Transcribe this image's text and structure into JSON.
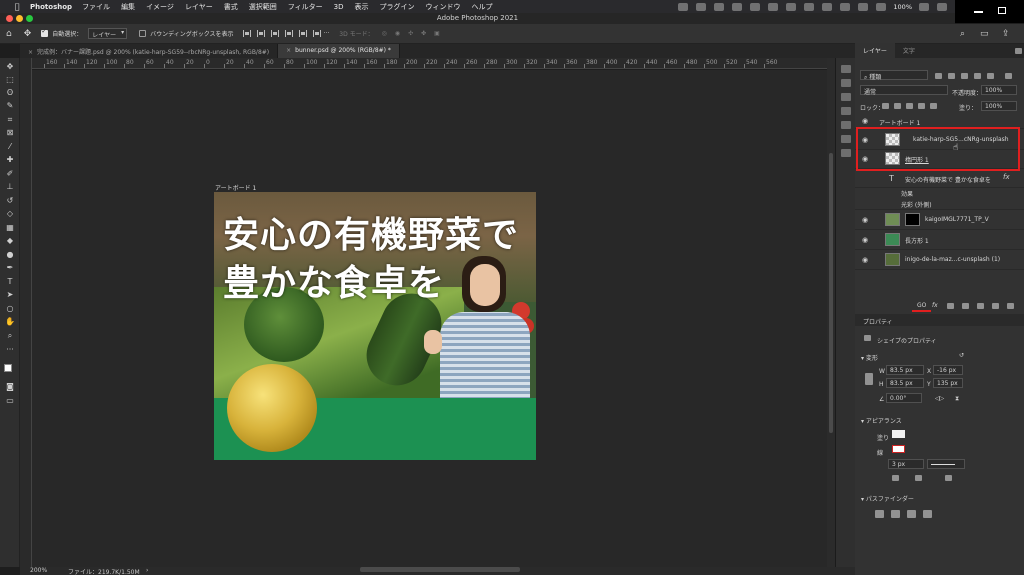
{
  "menubar": {
    "app_name": "Photoshop",
    "items": [
      "ファイル",
      "編集",
      "イメージ",
      "レイヤー",
      "書式",
      "選択範囲",
      "フィルター",
      "3D",
      "表示",
      "プラグイン",
      "ウィンドウ",
      "ヘルプ"
    ],
    "battery": "100%"
  },
  "window": {
    "title": "Adobe Photoshop 2021"
  },
  "options": {
    "auto_select_label": "自動選択：",
    "auto_select_value": "レイヤー",
    "bounding_box_label": "バウンディングボックスを表示",
    "mode_3d": "3D モード："
  },
  "tabs": [
    {
      "label": "完成例：バナー課題.psd @ 200% (katie-harp-SG59--rbcNRg-unsplash, RGB/8#)"
    },
    {
      "label": "bunner.psd @ 200% (RGB/8#) *"
    }
  ],
  "ruler": {
    "ticks": [
      "160",
      "140",
      "120",
      "100",
      "80",
      "60",
      "40",
      "20",
      "0",
      "20",
      "40",
      "60",
      "80",
      "100",
      "120",
      "140",
      "160",
      "180",
      "200",
      "220",
      "240",
      "260",
      "280",
      "300",
      "320",
      "340",
      "360",
      "380",
      "400",
      "420",
      "440",
      "460",
      "480",
      "500",
      "520",
      "540",
      "560"
    ]
  },
  "artboard": {
    "label": "アートボード 1",
    "headline_line1": "安心の有機野菜で",
    "headline_line2": "豊かな食卓を",
    "colors": {
      "band": "#1c9152",
      "gold": "#d8b33b"
    }
  },
  "statusbar": {
    "zoom": "200%",
    "file_info": "ファイル：219.7K/1.50M"
  },
  "layers_panel": {
    "tabs": [
      "レイヤー",
      "文字"
    ],
    "filter_label": "種類",
    "blend_mode": "通常",
    "opacity_label": "不透明度：",
    "opacity_value": "100%",
    "lock_label": "ロック：",
    "fill_label": "塗り：",
    "fill_value": "100%",
    "layers": [
      {
        "name": "アートボード 1"
      },
      {
        "name": "katie-harp-SG5...cNRg-unsplash"
      },
      {
        "name": "楕円形 1"
      },
      {
        "name": "安心の有機野菜で 豊かな食卓を"
      },
      {
        "name": "効果"
      },
      {
        "name": "光彩 (外側)"
      },
      {
        "name": "kaigoIMGL7771_TP_V"
      },
      {
        "name": "長方形 1"
      },
      {
        "name": "inigo-de-la-maz...c-unsplash (1)"
      }
    ],
    "highlight_color": "#e01f1f"
  },
  "properties_panel": {
    "title": "プロパティ",
    "shape_props": "シェイプのプロパティ",
    "transform_label": "変形",
    "w_label": "W",
    "w_value": "83.5 px",
    "h_label": "H",
    "h_value": "83.5 px",
    "x_label": "X",
    "x_value": "-16 px",
    "y_label": "Y",
    "y_value": "135 px",
    "angle_value": "0.00°",
    "appearance_label": "アピアランス",
    "fill_label": "塗り",
    "stroke_label": "線",
    "stroke_width": "3 px",
    "pathfinder_label": "パスファインダー"
  }
}
